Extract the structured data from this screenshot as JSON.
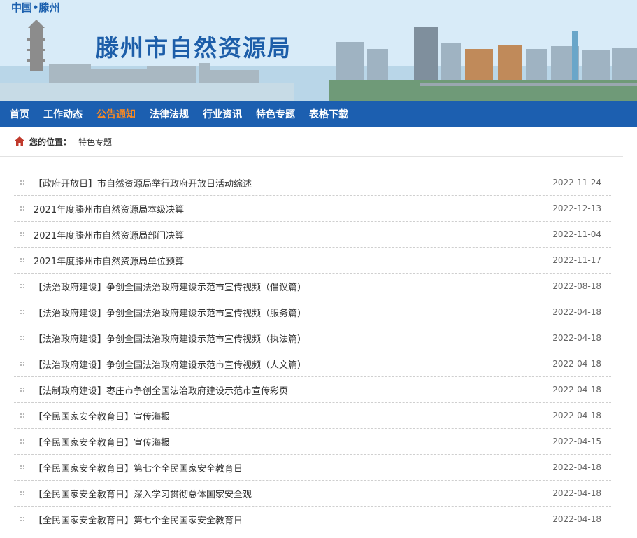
{
  "header": {
    "city_tag": "中国•滕州",
    "site_title": "滕州市自然资源局"
  },
  "nav": {
    "items": [
      {
        "label": "首页",
        "active": false
      },
      {
        "label": "工作动态",
        "active": false
      },
      {
        "label": "公告通知",
        "active": true
      },
      {
        "label": "法律法规",
        "active": false
      },
      {
        "label": "行业资讯",
        "active": false
      },
      {
        "label": "特色专题",
        "active": false
      },
      {
        "label": "表格下载",
        "active": false
      }
    ],
    "active_color": "#ff8a1e",
    "bar_color": "#1c5fb0"
  },
  "breadcrumb": {
    "label": "您的位置：",
    "current": "特色专题",
    "icon": "home-icon"
  },
  "articles": [
    {
      "title": "【政府开放日】市自然资源局举行政府开放日活动综述",
      "date": "2022-11-24"
    },
    {
      "title": "2021年度滕州市自然资源局本级决算",
      "date": "2022-12-13"
    },
    {
      "title": "2021年度滕州市自然资源局部门决算",
      "date": "2022-11-04"
    },
    {
      "title": "2021年度滕州市自然资源局单位预算",
      "date": "2022-11-17"
    },
    {
      "title": "【法治政府建设】争创全国法治政府建设示范市宣传视频（倡议篇）",
      "date": "2022-08-18"
    },
    {
      "title": "【法治政府建设】争创全国法治政府建设示范市宣传视频（服务篇）",
      "date": "2022-04-18"
    },
    {
      "title": "【法治政府建设】争创全国法治政府建设示范市宣传视频（执法篇）",
      "date": "2022-04-18"
    },
    {
      "title": "【法治政府建设】争创全国法治政府建设示范市宣传视频（人文篇）",
      "date": "2022-04-18"
    },
    {
      "title": "【法制政府建设】枣庄市争创全国法治政府建设示范市宣传彩页",
      "date": "2022-04-18"
    },
    {
      "title": "【全民国家安全教育日】宣传海报",
      "date": "2022-04-18"
    },
    {
      "title": "【全民国家安全教育日】宣传海报",
      "date": "2022-04-15"
    },
    {
      "title": "【全民国家安全教育日】第七个全民国家安全教育日",
      "date": "2022-04-18"
    },
    {
      "title": "【全民国家安全教育日】深入学习贯彻总体国家安全观",
      "date": "2022-04-18"
    },
    {
      "title": "【全民国家安全教育日】第七个全民国家安全教育日",
      "date": "2022-04-18"
    }
  ]
}
